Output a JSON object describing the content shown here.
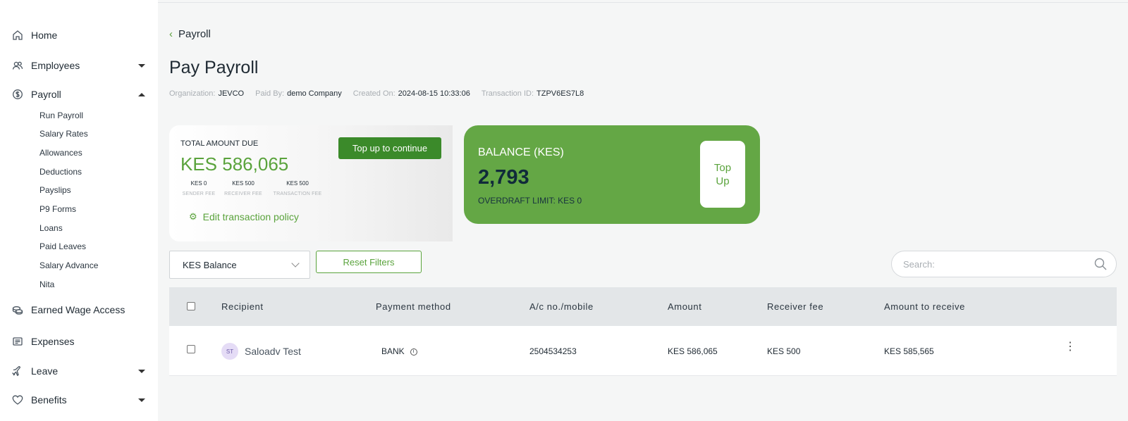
{
  "sidebar": {
    "items": [
      {
        "label": "Home",
        "icon": "home-icon"
      },
      {
        "label": "Employees",
        "icon": "users-icon"
      },
      {
        "label": "Payroll",
        "icon": "dollar-circle-icon"
      },
      {
        "label": "Earned Wage Access",
        "icon": "coins-icon"
      },
      {
        "label": "Expenses",
        "icon": "receipt-icon"
      },
      {
        "label": "Leave",
        "icon": "plane-icon"
      },
      {
        "label": "Benefits",
        "icon": "heart-icon"
      }
    ],
    "payroll_sub": [
      "Run Payroll",
      "Salary Rates",
      "Allowances",
      "Deductions",
      "Payslips",
      "P9 Forms",
      "Loans",
      "Paid Leaves",
      "Salary Advance",
      "Nita"
    ]
  },
  "header": {
    "back_label": "Payroll",
    "title": "Pay Payroll",
    "meta": {
      "org_label": "Organization:",
      "org_value": "JEVCO",
      "paidby_label": "Paid By:",
      "paidby_value": "demo Company",
      "created_label": "Created On:",
      "created_value": "2024-08-15 10:33:06",
      "txn_label": "Transaction ID:",
      "txn_value": "TZPV6ES7L8"
    }
  },
  "due_card": {
    "label": "TOTAL AMOUNT DUE",
    "amount": "KES 586,065",
    "topup_button": "Top up to continue",
    "fees": [
      {
        "value": "KES 0",
        "label": "SENDER FEE"
      },
      {
        "value": "KES 500",
        "label": "RECEIVER FEE"
      },
      {
        "value": "KES 500",
        "label": "TRANSACTION FEE"
      }
    ],
    "edit_policy": "Edit transaction policy"
  },
  "balance_card": {
    "label": "BALANCE (KES)",
    "amount": "2,793",
    "overdraft": "OVERDRAFT LIMIT: KES 0",
    "topup_line1": "Top",
    "topup_line2": "Up"
  },
  "filters": {
    "select_value": "KES Balance",
    "reset_label": "Reset Filters",
    "search_placeholder": "Search:"
  },
  "table": {
    "headers": [
      "Recipient",
      "Payment method",
      "A/c no./mobile",
      "Amount",
      "Receiver fee",
      "Amount to receive"
    ],
    "rows": [
      {
        "initials": "ST",
        "recipient": "Saloadv Test",
        "method": "BANK",
        "account": "2504534253",
        "amount": "KES 586,065",
        "receiver_fee": "KES 500",
        "amount_to_receive": "KES 585,565"
      }
    ]
  },
  "colors": {
    "accent_green": "#5aa33c",
    "button_green": "#3b8a2a",
    "balance_card_green": "#64a745"
  }
}
